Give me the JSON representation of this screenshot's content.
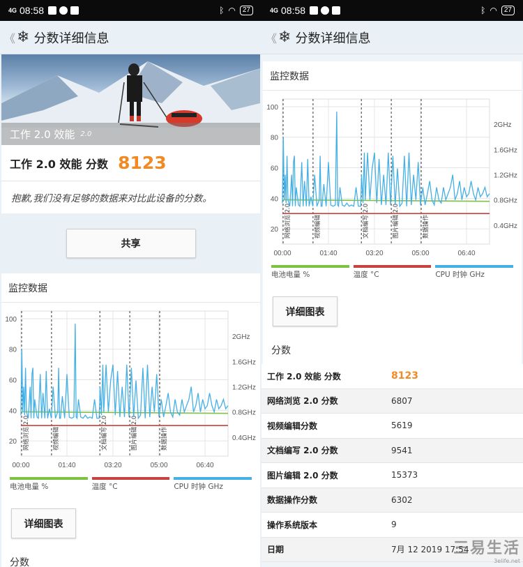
{
  "status": {
    "signal": "4G",
    "time": "08:58",
    "battery": "27"
  },
  "appbar": {
    "title": "分数详细信息"
  },
  "hero": {
    "label": "工作 2.0 效能",
    "version": "2.0"
  },
  "score": {
    "label": "工作 2.0 效能 分数",
    "value": "8123"
  },
  "notice": "抱歉,我们没有足够的数据来对比此设备的分数。",
  "share_label": "共享",
  "monitor_title": "监控数据",
  "detail_chart_label": "详细图表",
  "scores_title": "分数",
  "legend": [
    {
      "label": "电池电量 %",
      "color": "#7cc243"
    },
    {
      "label": "温度 °C",
      "color": "#c8423f"
    },
    {
      "label": "CPU 时钟 GHz",
      "color": "#45b0e6"
    }
  ],
  "chart_data": {
    "type": "line",
    "xlabel": "",
    "ylabel": "",
    "x_ticks": [
      "00:00",
      "01:40",
      "03:20",
      "05:00",
      "06:40"
    ],
    "y_ticks_left": [
      20,
      40,
      60,
      80,
      100
    ],
    "y_ticks_right": [
      "0.4GHz",
      "0.8GHz",
      "1.2GHz",
      "1.6GHz",
      "2GHz"
    ],
    "segments": [
      "网络浏览 2.0",
      "视频编辑",
      "文档编写 2.0",
      "图片编辑 2.0",
      "数据操作"
    ],
    "segment_boundaries_min": [
      0,
      65,
      170,
      235,
      300
    ],
    "x_max_min": 450,
    "series": [
      {
        "name": "电池电量 %",
        "color": "#7cc243",
        "x": [
          0,
          450
        ],
        "values": [
          39,
          38
        ]
      },
      {
        "name": "温度 °C",
        "color": "#c8423f",
        "x": [
          0,
          450
        ],
        "values": [
          30,
          30
        ]
      },
      {
        "name": "CPU 时钟 GHz",
        "color": "#45b0e6",
        "x": [
          0,
          2,
          4,
          6,
          8,
          10,
          12,
          16,
          20,
          22,
          24,
          26,
          28,
          30,
          35,
          38,
          42,
          45,
          48,
          52,
          55,
          58,
          62,
          66,
          70,
          75,
          80,
          82,
          84,
          86,
          90,
          95,
          100,
          105,
          110,
          115,
          118,
          120,
          122,
          125,
          130,
          135,
          140,
          145,
          150,
          155,
          160,
          165,
          170,
          172,
          175,
          178,
          180,
          185,
          190,
          195,
          200,
          205,
          210,
          215,
          220,
          225,
          230,
          235,
          240,
          245,
          250,
          255,
          260,
          265,
          270,
          275,
          280,
          285,
          290,
          295,
          300,
          305,
          310,
          315,
          320,
          325,
          330,
          335,
          340,
          345,
          350,
          355,
          360,
          365,
          370,
          375,
          380,
          385,
          390,
          395,
          400,
          405,
          410,
          415,
          420,
          425,
          430,
          435,
          440,
          445,
          450
        ],
        "values": [
          0.75,
          1.8,
          0.8,
          1.2,
          0.75,
          1.5,
          0.8,
          0.7,
          1.2,
          0.7,
          1.4,
          1.5,
          0.7,
          1.0,
          0.72,
          0.7,
          1.4,
          0.7,
          1.1,
          0.7,
          1.45,
          0.7,
          0.85,
          0.7,
          1.2,
          0.7,
          0.8,
          1.5,
          0.7,
          0.7,
          1.05,
          0.7,
          1.4,
          0.72,
          0.7,
          0.72,
          2.2,
          0.72,
          0.7,
          1.0,
          0.72,
          0.7,
          0.75,
          0.7,
          0.72,
          0.7,
          1.0,
          0.7,
          0.7,
          1.2,
          0.75,
          1.55,
          0.8,
          1.55,
          0.8,
          1.3,
          1.55,
          0.75,
          1.45,
          0.72,
          1.2,
          0.72,
          1.55,
          0.72,
          1.5,
          0.72,
          1.3,
          0.7,
          0.75,
          1.5,
          0.7,
          1.55,
          0.72,
          1.2,
          0.8,
          1.4,
          0.72,
          1.0,
          0.72,
          0.9,
          1.1,
          0.8,
          0.72,
          1.0,
          0.8,
          0.75,
          1.0,
          0.8,
          0.9,
          1.0,
          1.2,
          0.8,
          0.9,
          1.1,
          0.8,
          1.0,
          0.85,
          0.9,
          1.1,
          0.9,
          0.8,
          1.0,
          0.85,
          0.9,
          1.0,
          0.85,
          0.9
        ]
      }
    ],
    "ylim": [
      10,
      105
    ],
    "y2lim": [
      0.1,
      2.4
    ]
  },
  "score_rows": [
    {
      "label": "工作 2.0 效能 分数",
      "value": "8123",
      "highlight": true
    },
    {
      "label": "网络浏览 2.0 分数",
      "value": "6807"
    },
    {
      "label": "视频编辑分数",
      "value": "5619"
    },
    {
      "label": "文档编写 2.0 分数",
      "value": "9541"
    },
    {
      "label": "图片编辑 2.0 分数",
      "value": "15373"
    },
    {
      "label": "数据操作分数",
      "value": "6302"
    },
    {
      "label": "操作系统版本",
      "value": "9"
    },
    {
      "label": "日期",
      "value": "7月 12 2019 17:54"
    }
  ],
  "watermark": {
    "main": "三易生活",
    "sub": "3elife.net"
  }
}
